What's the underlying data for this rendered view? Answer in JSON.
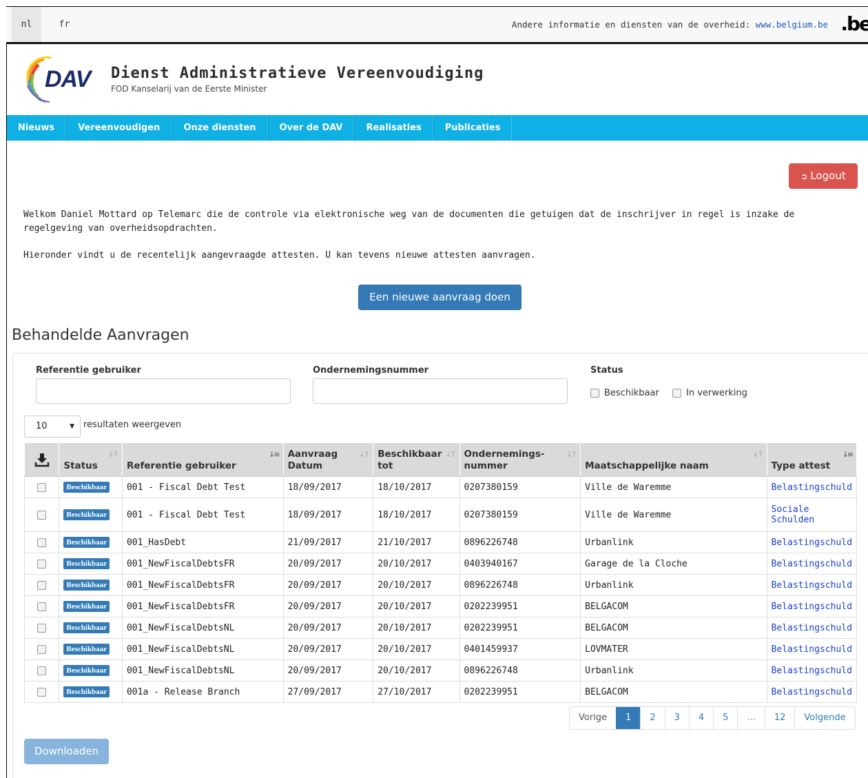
{
  "topbar": {
    "lang_nl": "nl",
    "lang_fr": "fr",
    "other_info": "Andere informatie en diensten van de overheid: ",
    "other_link": "www.belgium.be",
    "be_logo": ".be"
  },
  "header": {
    "logo_text": "DAV",
    "title": "Dienst Administratieve Vereenvoudiging",
    "subtitle": "FOD Kanselarij van de Eerste Minister"
  },
  "nav": [
    "Nieuws",
    "Vereenvoudigen",
    "Onze diensten",
    "Over de DAV",
    "Realisaties",
    "Publicaties"
  ],
  "logout_label": "Logout",
  "intro": "Welkom Daniel Mottard op Telemarc die de controle via elektronische weg van de documenten die getuigen dat de inschrijver in regel is inzake de regelgeving van overheidsopdrachten.",
  "intro2": "Hieronder vindt u de recentelijk aangevraagde attesten. U kan tevens nieuwe attesten aanvragen.",
  "new_request": "Een nieuwe aanvraag doen",
  "section_title": "Behandelde Aanvragen",
  "filters": {
    "ref_label": "Referentie gebruiker",
    "ref_value": "",
    "ond_label": "Ondernemingsnummer",
    "ond_value": "",
    "status_label": "Status",
    "status_options": [
      "Beschikbaar",
      "In verwerking"
    ]
  },
  "length": {
    "value": "10",
    "label": "resultaten weergeven"
  },
  "table": {
    "headers": [
      "Status",
      "Referentie gebruiker",
      "Aanvraag Datum",
      "Beschikbaar tot",
      "Ondernemings- nummer",
      "Maatschappelijke naam",
      "Type attest"
    ],
    "rows": [
      {
        "status": "Beschikbaar",
        "ref": "001 - Fiscal Debt Test",
        "datum": "18/09/2017",
        "tot": "18/10/2017",
        "nummer": "0207380159",
        "naam": "Ville de Waremme",
        "type": "Belastingschuld"
      },
      {
        "status": "Beschikbaar",
        "ref": "001 - Fiscal Debt Test",
        "datum": "18/09/2017",
        "tot": "18/10/2017",
        "nummer": "0207380159",
        "naam": "Ville de Waremme",
        "type": "Sociale Schulden"
      },
      {
        "status": "Beschikbaar",
        "ref": "001_HasDebt",
        "datum": "21/09/2017",
        "tot": "21/10/2017",
        "nummer": "0896226748",
        "naam": "Urbanlink",
        "type": "Belastingschuld"
      },
      {
        "status": "Beschikbaar",
        "ref": "001_NewFiscalDebtsFR",
        "datum": "20/09/2017",
        "tot": "20/10/2017",
        "nummer": "0403940167",
        "naam": "Garage de la Cloche",
        "type": "Belastingschuld"
      },
      {
        "status": "Beschikbaar",
        "ref": "001_NewFiscalDebtsFR",
        "datum": "20/09/2017",
        "tot": "20/10/2017",
        "nummer": "0896226748",
        "naam": "Urbanlink",
        "type": "Belastingschuld"
      },
      {
        "status": "Beschikbaar",
        "ref": "001_NewFiscalDebtsFR",
        "datum": "20/09/2017",
        "tot": "20/10/2017",
        "nummer": "0202239951",
        "naam": "BELGACOM",
        "type": "Belastingschuld"
      },
      {
        "status": "Beschikbaar",
        "ref": "001_NewFiscalDebtsNL",
        "datum": "20/09/2017",
        "tot": "20/10/2017",
        "nummer": "0202239951",
        "naam": "BELGACOM",
        "type": "Belastingschuld"
      },
      {
        "status": "Beschikbaar",
        "ref": "001_NewFiscalDebtsNL",
        "datum": "20/09/2017",
        "tot": "20/10/2017",
        "nummer": "0401459937",
        "naam": "LOVMATER",
        "type": "Belastingschuld"
      },
      {
        "status": "Beschikbaar",
        "ref": "001_NewFiscalDebtsNL",
        "datum": "20/09/2017",
        "tot": "20/10/2017",
        "nummer": "0896226748",
        "naam": "Urbanlink",
        "type": "Belastingschuld"
      },
      {
        "status": "Beschikbaar",
        "ref": "001a - Release Branch",
        "datum": "27/09/2017",
        "tot": "27/10/2017",
        "nummer": "0202239951",
        "naam": "BELGACOM",
        "type": "Belastingschuld"
      }
    ]
  },
  "pagination": [
    "Vorige",
    "1",
    "2",
    "3",
    "4",
    "5",
    "...",
    "12",
    "Volgende"
  ],
  "download_label": "Downloaden"
}
